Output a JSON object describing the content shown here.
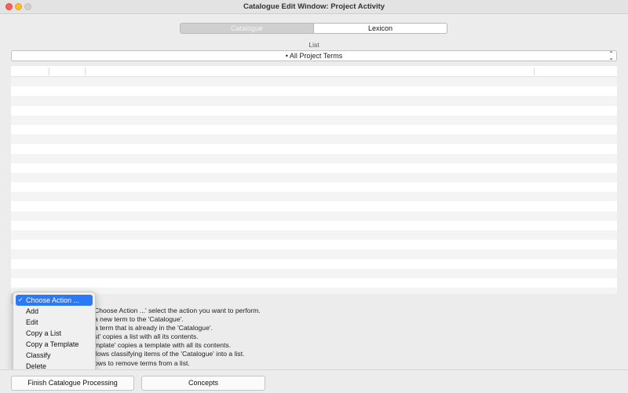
{
  "window": {
    "title": "Catalogue Edit Window: Project Activity"
  },
  "tabs": [
    {
      "label": "Catalogue",
      "selected": true
    },
    {
      "label": "Lexicon",
      "selected": false
    }
  ],
  "list": {
    "label": "List",
    "selected_value": "• All Project Terms"
  },
  "action_menu": {
    "items": [
      {
        "label": "Choose Action ...",
        "checked": true
      },
      {
        "label": "Add"
      },
      {
        "label": "Edit"
      },
      {
        "label": "Copy a List"
      },
      {
        "label": "Copy a Template"
      },
      {
        "label": "Classify"
      },
      {
        "label": "Delete"
      }
    ]
  },
  "help": {
    "lines": [
      "Choose Action ...'  select the action you want to perform.",
      "a new term to the 'Catalogue'.",
      "a term that is already in the 'Catalogue'.",
      "st' copies a list with all its contents.",
      "mplate' copies a template with all its contents.",
      "llows classifying items of the 'Catalogue' into a list.",
      "ows to remove terms from a list."
    ]
  },
  "buttons": {
    "finish": "Finish Catalogue Processing",
    "concepts": "Concepts"
  },
  "colors": {
    "accent": "#2b79f6",
    "close": "#fe5f57",
    "minimize": "#febc2e"
  }
}
